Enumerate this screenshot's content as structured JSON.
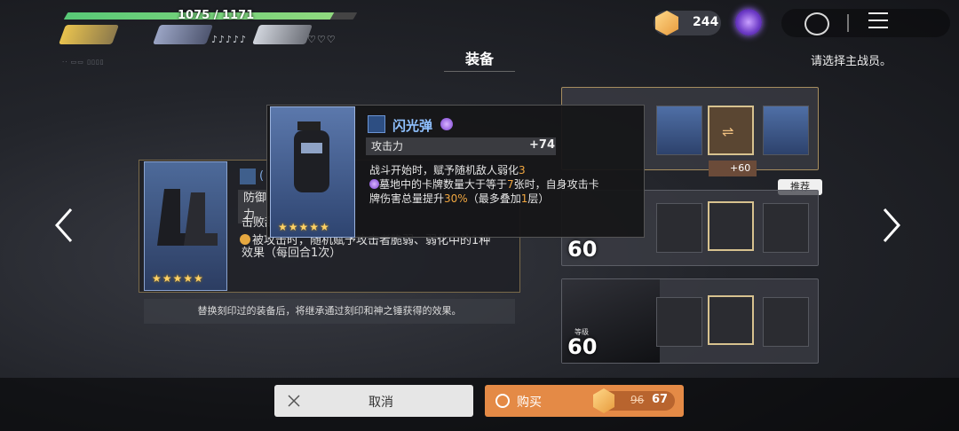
{
  "hud": {
    "hp_text": "1075 / 1171",
    "hp_fraction": 0.92,
    "notes_1": "♪♪♪♪♪",
    "notes_2": "♡♡♡",
    "team_line": "·· ▭▭ ▯▯▯▯",
    "currency": "244"
  },
  "header": {
    "title": "装备",
    "hint": "请选择主战员。"
  },
  "current_equip": {
    "name_partial": "(",
    "stat_label": "防御力",
    "line1": "击败敌",
    "line2": "被攻击时，随机赋予攻击者脆弱、弱化中的1种",
    "line3": "效果（每回合1次）",
    "stars": "★★★★★",
    "replace_note": "替换刻印过的装备后，将继承通过刻印和神之锤获得的效果。"
  },
  "tooltip": {
    "name": "闪光弹",
    "stat_label": "攻击力",
    "stat_value": "+74",
    "desc_1a": "战斗开始时，赋予随机敌人弱化",
    "desc_1b": "3",
    "desc_2a": "墓地中的卡牌数量大于等于",
    "desc_2b": "7",
    "desc_2c": "张时，自身攻击卡",
    "desc_3a": "牌伤害总量提升",
    "desc_3b": "30%",
    "desc_3c": "（最多叠加",
    "desc_3d": "1",
    "desc_3e": "层）",
    "stars": "★★★★★"
  },
  "right_panel": {
    "slot_stars": "★★★★★",
    "plus_value": "+60",
    "recommend": "推荐",
    "level_tag": "等级",
    "level_2": "60",
    "level_3": "60"
  },
  "footer": {
    "cancel_label": "取消",
    "buy_label": "购买",
    "price_old": "96",
    "price_new": "67"
  },
  "colors": {
    "accent_orange": "#e48a46",
    "hp_green": "#58c977",
    "highlight": "#f0a640"
  }
}
